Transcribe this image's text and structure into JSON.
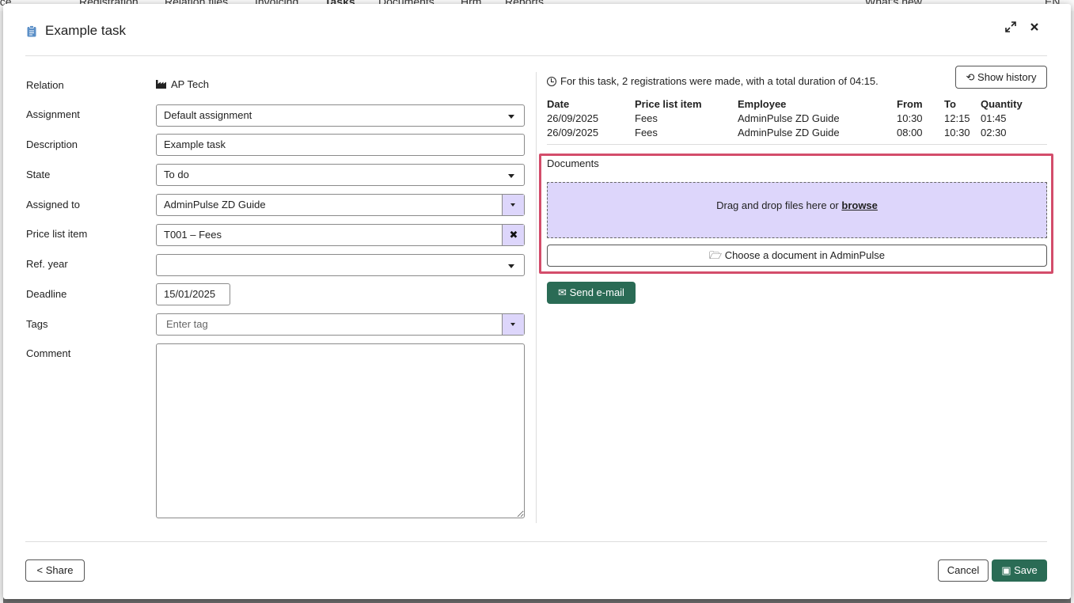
{
  "background_nav": [
    "nce",
    "Registration",
    "Relation files",
    "Invoicing",
    "Tasks",
    "Documents",
    "Hrm",
    "Reports",
    "What's new",
    "EN"
  ],
  "modal": {
    "title": "Example task",
    "expand_icon": "expand-icon",
    "close_icon": "close-icon"
  },
  "form": {
    "relation": {
      "label": "Relation",
      "value": "AP Tech"
    },
    "assignment": {
      "label": "Assignment",
      "value": "Default assignment"
    },
    "description": {
      "label": "Description",
      "value": "Example task"
    },
    "state": {
      "label": "State",
      "value": "To do"
    },
    "assigned_to": {
      "label": "Assigned to",
      "value": "AdminPulse ZD Guide"
    },
    "price_list_item": {
      "label": "Price list item",
      "value": "T001 – Fees"
    },
    "ref_year": {
      "label": "Ref. year",
      "value": ""
    },
    "deadline": {
      "label": "Deadline",
      "value": "15/01/2025"
    },
    "tags": {
      "label": "Tags",
      "placeholder": "Enter tag"
    },
    "comment": {
      "label": "Comment",
      "value": ""
    }
  },
  "registrations": {
    "summary": "For this task, 2 registrations were made, with a total duration of 04:15.",
    "show_history_label": "Show history",
    "columns": [
      "Date",
      "Price list item",
      "Employee",
      "From",
      "To",
      "Quantity"
    ],
    "rows": [
      [
        "26/09/2025",
        "Fees",
        "AdminPulse ZD Guide",
        "10:30",
        "12:15",
        "01:45"
      ],
      [
        "26/09/2025",
        "Fees",
        "AdminPulse ZD Guide",
        "08:00",
        "10:30",
        "02:30"
      ]
    ]
  },
  "documents": {
    "label": "Documents",
    "dropzone_text": "Drag and drop files here or ",
    "browse_label": "browse",
    "choose_label": "Choose a document in AdminPulse"
  },
  "send_email_label": "Send e-mail",
  "footer": {
    "share_label": "Share",
    "cancel_label": "Cancel",
    "save_label": "Save"
  },
  "colors": {
    "accent_green": "#2a6b55",
    "addon_purple": "#ddd6fb",
    "highlight_red": "#d34d6b"
  }
}
